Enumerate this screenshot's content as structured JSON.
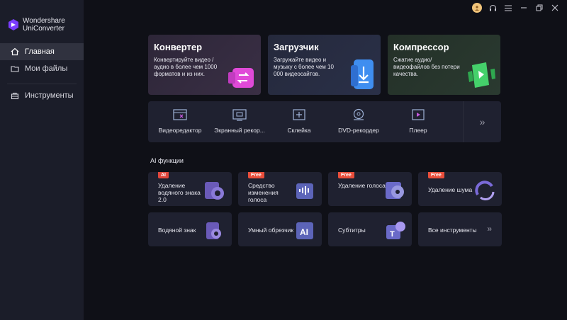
{
  "app": {
    "brand_line1": "Wondershare",
    "brand_line2": "UniConverter"
  },
  "sidebar": {
    "items": [
      {
        "label": "Главная",
        "icon": "home-icon",
        "active": true
      },
      {
        "label": "Мои файлы",
        "icon": "folder-icon",
        "active": false
      },
      {
        "label": "Инструменты",
        "icon": "toolbox-icon",
        "active": false
      }
    ]
  },
  "topbar": {
    "icons": [
      "avatar",
      "headset-icon",
      "menu-icon",
      "minimize-icon",
      "restore-icon",
      "close-icon"
    ]
  },
  "hero_cards": [
    {
      "title": "Конвертер",
      "desc": "Конвертируйте видео / аудио в более чем 1000 форматов и из них.",
      "color": "#3a2f45"
    },
    {
      "title": "Загрузчик",
      "desc": "Загружайте видео и музыку с более чем 10 000 видеосайтов.",
      "color": "#2a3048"
    },
    {
      "title": "Компрессор",
      "desc": "Сжатие аудио/ видеофайлов без потери качества.",
      "color": "#2a3a30"
    }
  ],
  "tools": [
    {
      "label": "Видеоредактор",
      "icon": "video-editor-icon"
    },
    {
      "label": "Экранный рекор...",
      "icon": "screen-recorder-icon"
    },
    {
      "label": "Склейка",
      "icon": "merger-icon"
    },
    {
      "label": "DVD-рекордер",
      "icon": "dvd-icon"
    },
    {
      "label": "Плеер",
      "icon": "player-icon"
    }
  ],
  "ai_section": {
    "title": "AI функции",
    "cards": [
      {
        "label": "Удаление водяного знака 2.0",
        "badge": "AI"
      },
      {
        "label": "Средство изменения голоса",
        "badge": "Free"
      },
      {
        "label": "Удаление голоса",
        "badge": "Free"
      },
      {
        "label": "Удаление шума",
        "badge": "Free"
      },
      {
        "label": "Водяной знак",
        "badge": ""
      },
      {
        "label": "Умный обрезчик",
        "badge": ""
      },
      {
        "label": "Субтитры",
        "badge": ""
      },
      {
        "label": "Все инструменты",
        "badge": ""
      }
    ]
  }
}
